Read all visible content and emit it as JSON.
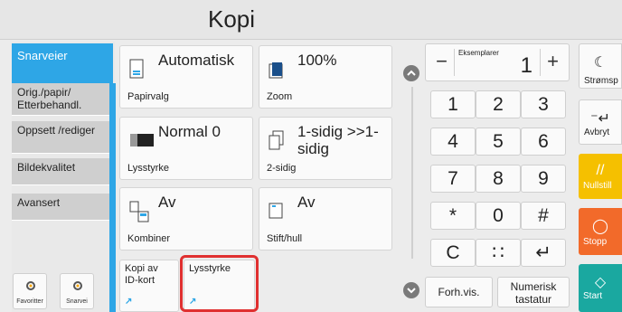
{
  "title": "Kopi",
  "sidebar": {
    "active_tab": "Snarveier",
    "tabs": [
      "Orig./papir/ Etterbehandl.",
      "Oppsett /rediger",
      "Bildekvalitet",
      "Avansert"
    ],
    "bottom_buttons": [
      "Favoritter",
      "Snarvei"
    ]
  },
  "cards": [
    {
      "value": "Automatisk",
      "sub": "Papirvalg",
      "icon": "paper-icon"
    },
    {
      "value": "100%",
      "sub": "Zoom",
      "icon": "zoom-icon"
    },
    {
      "value": "Normal 0",
      "sub": "Lysstyrke",
      "icon": "density-icon"
    },
    {
      "value": "1-sidig >>1-sidig",
      "sub": "2-sidig",
      "icon": "duplex-icon"
    },
    {
      "value": "Av",
      "sub": "Kombiner",
      "icon": "combine-icon"
    },
    {
      "value": "Av",
      "sub": "Stift/hull",
      "icon": "staple-icon"
    }
  ],
  "shortcuts": [
    "Kopi av ID-kort",
    "Lysstyrke"
  ],
  "copies": {
    "label": "Eksemplarer",
    "value": "1",
    "minus": "−",
    "plus": "+"
  },
  "keypad": [
    "1",
    "2",
    "3",
    "4",
    "5",
    "6",
    "7",
    "8",
    "9",
    "*",
    "0",
    "#",
    "C",
    "∷",
    "↵"
  ],
  "bottom": {
    "forhvis": "Forh.vis.",
    "numerisk": "Numerisk tastatur"
  },
  "right_buttons": [
    {
      "label": "Strømsp",
      "color": "#fafafa",
      "text_color": "#222"
    },
    {
      "label": "Avbryt",
      "color": "#fafafa",
      "text_color": "#222"
    },
    {
      "label": "Nullstill",
      "color": "#f5c000",
      "text_color": "#fff"
    },
    {
      "label": "Stopp",
      "color": "#f26a2a",
      "text_color": "#fff"
    },
    {
      "label": "Start",
      "color": "#1aa8a0",
      "text_color": "#fff"
    }
  ]
}
